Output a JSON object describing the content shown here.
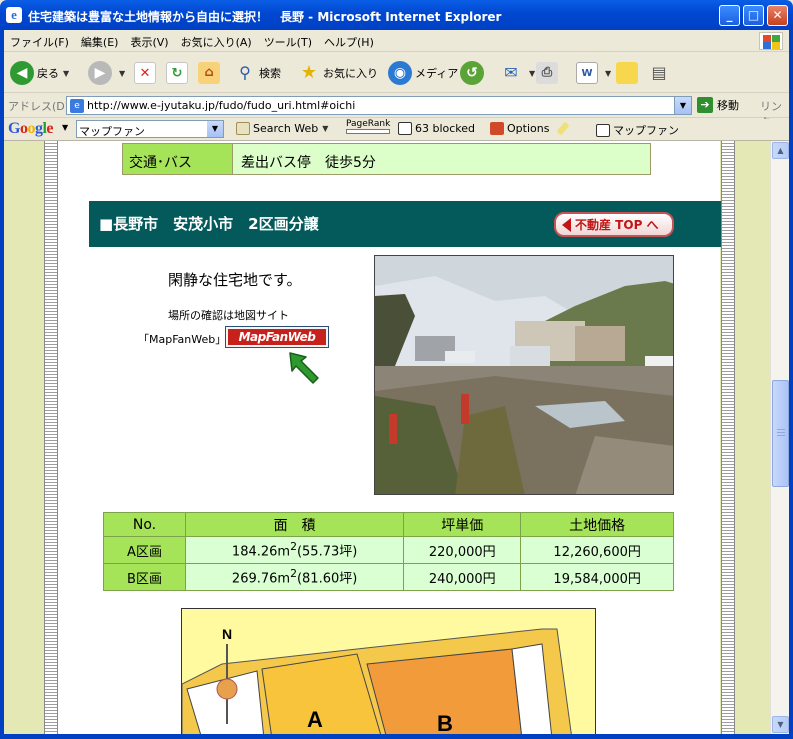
{
  "window": {
    "title": "住宅建築は豊富な土地情報から自由に選択！　長野 - Microsoft Internet Explorer",
    "min": "_",
    "max": "□",
    "close": "✕"
  },
  "menu": [
    "ファイル(F)",
    "編集(E)",
    "表示(V)",
    "お気に入り(A)",
    "ツール(T)",
    "ヘルプ(H)"
  ],
  "toolbar": {
    "back": "戻る",
    "search": "検索",
    "favorites": "お気に入り",
    "media": "メディア"
  },
  "address": {
    "label": "アドレス(D)",
    "url": "http://www.e-jyutaku.jp/fudo/fudo_uri.html#oichi",
    "go": "移動",
    "links": "リンク"
  },
  "google": {
    "logo": "Google",
    "query": "マップファン",
    "search_web": "Search Web",
    "pagerank": "PageRank",
    "blocked": "63 blocked",
    "options": "Options",
    "highlight": "マップファン"
  },
  "page": {
    "transport": {
      "label": "交通･バス",
      "value": "差出バス停　徒歩5分"
    },
    "heading": "■長野市　安茂小市　2区画分譲",
    "top_button": "不動産 TOP へ",
    "description": "閑静な住宅地です。",
    "location_line1": "場所の確認は地図サイト",
    "location_line2": "「MapFanWeb」",
    "mapfan_logo": "MapFanWeb",
    "table": {
      "headers": [
        "No.",
        "面　積",
        "坪単価",
        "土地価格"
      ],
      "rows": [
        {
          "no": "A区画",
          "area": "184.26m",
          "sup": "2",
          "tsubo": "(55.73坪)",
          "unit": "220,000円",
          "price": "12,260,600円"
        },
        {
          "no": "B区画",
          "area": "269.76m",
          "sup": "2",
          "tsubo": "(81.60坪)",
          "unit": "240,000円",
          "price": "19,584,000円"
        }
      ]
    },
    "map": {
      "north": "N",
      "lot_a": "A",
      "lot_b": "B"
    }
  }
}
